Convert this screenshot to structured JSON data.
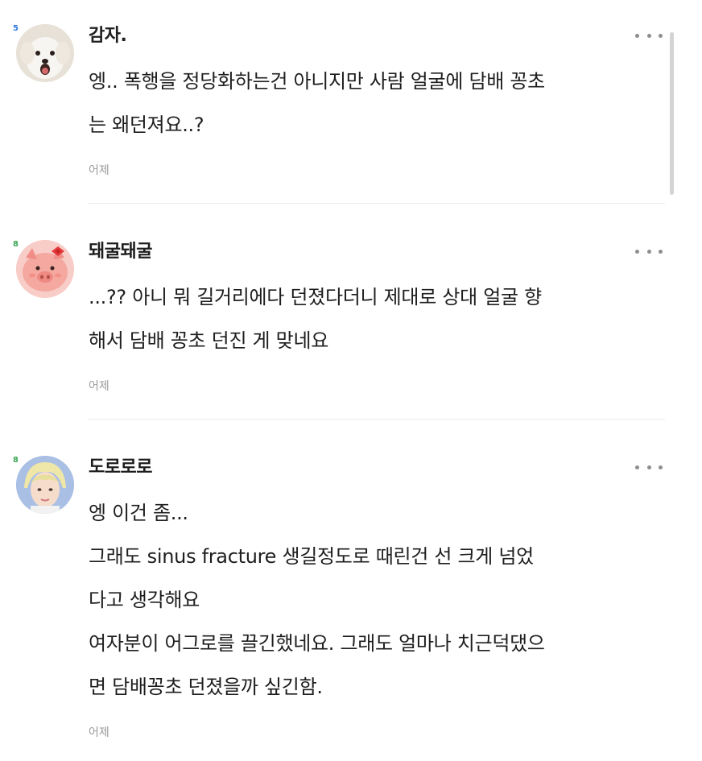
{
  "comments": [
    {
      "level": "5",
      "level_color": "#2e7be0",
      "nickname": "감자.",
      "lines": [
        "엥.. 폭행을 정당화하는건 아니지만 사람 얼굴에 담배 꽁초",
        "는 왜던져요..?"
      ],
      "date": "어제",
      "avatar_icon": "white-dog-avatar-icon"
    },
    {
      "level": "8",
      "level_color": "#3aa655",
      "nickname": "돼굴돼굴",
      "lines": [
        "...?? 아니 뭐 길거리에다 던졌다더니 제대로 상대 얼굴 향",
        "해서 담배 꽁초 던진 게 맞네요"
      ],
      "date": "어제",
      "avatar_icon": "pink-pig-avatar-icon"
    },
    {
      "level": "8",
      "level_color": "#3aa655",
      "nickname": "도로로로",
      "lines": [
        "엥 이건 좀...",
        "그래도 sinus fracture 생길정도로 때린건 선 크게 넘었",
        "다고 생각해요",
        "여자분이 어그로를 끌긴했네요. 그래도 얼마나 치근덕댔으",
        "면 담배꽁초 던졌을까 싶긴함."
      ],
      "date": "어제",
      "avatar_icon": "person-photo-avatar-icon"
    }
  ]
}
